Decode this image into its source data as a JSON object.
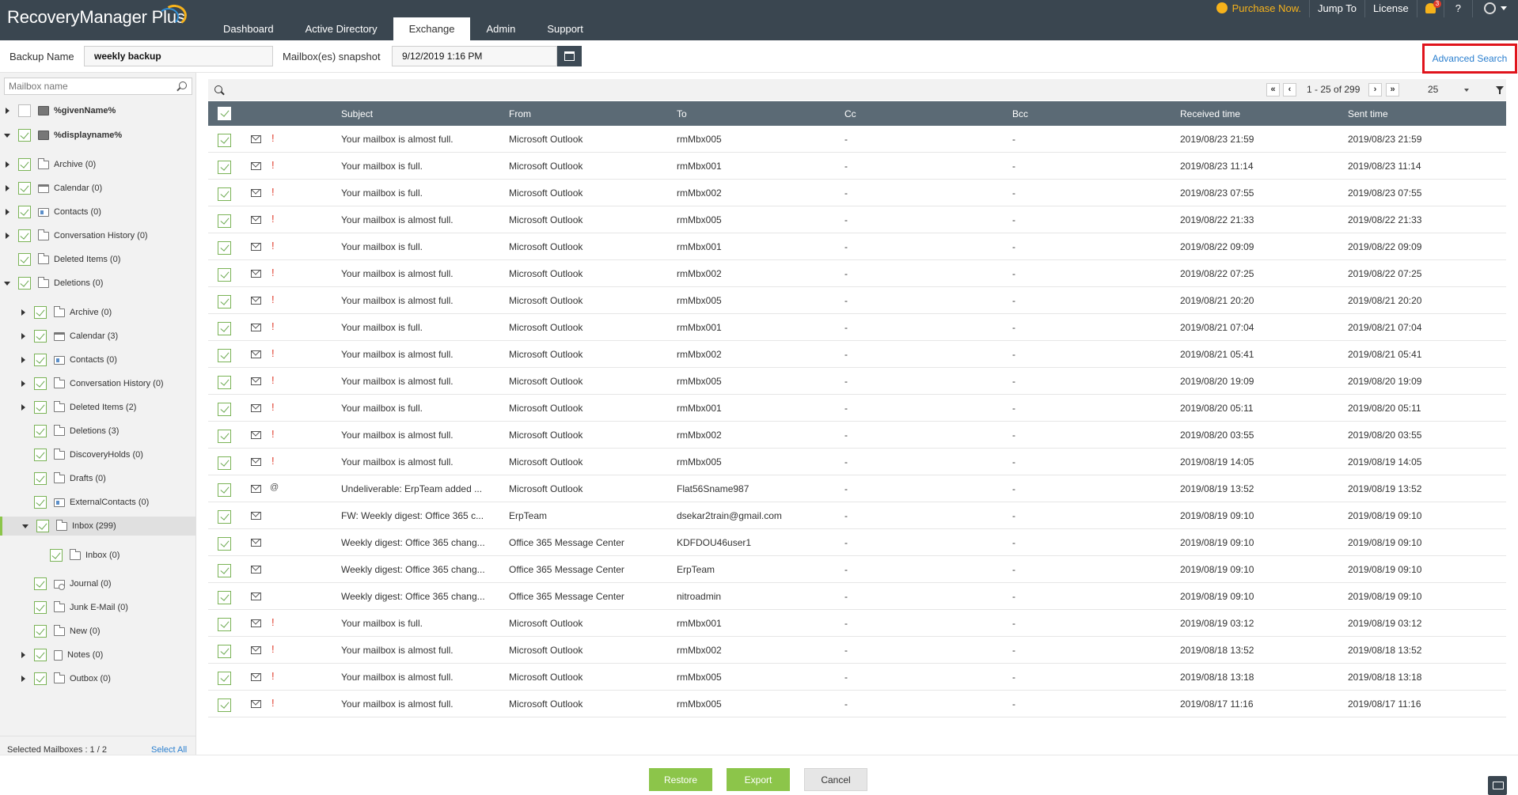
{
  "app": {
    "name": "RecoveryManager",
    "plus": "Plus"
  },
  "nav": {
    "tabs": [
      {
        "label": "Dashboard"
      },
      {
        "label": "Active Directory"
      },
      {
        "label": "Exchange",
        "active": true
      },
      {
        "label": "Admin"
      },
      {
        "label": "Support"
      }
    ]
  },
  "topright": {
    "purchase": "Purchase Now.",
    "jump": "Jump To",
    "license": "License",
    "notif_count": "3",
    "help": "?"
  },
  "filters": {
    "backup_label": "Backup Name",
    "backup_value": "weekly backup",
    "snapshot_label": "Mailbox(es) snapshot",
    "snapshot_value": "9/12/2019 1:16 PM",
    "advanced_search": "Advanced Search"
  },
  "sidebar": {
    "search_placeholder": "Mailbox name",
    "tree": [
      {
        "label": "%givenName%",
        "bold": true,
        "icon": "db",
        "indent": 0,
        "arrow": "r",
        "checked": false
      },
      {
        "label": "%displayname%",
        "bold": true,
        "icon": "db",
        "indent": 0,
        "arrow": "d",
        "checked": true
      },
      {
        "label": "Archive (0)",
        "icon": "folder",
        "indent": 1,
        "arrow": "r",
        "checked": true
      },
      {
        "label": "Calendar (0)",
        "icon": "calendar",
        "indent": 1,
        "arrow": "r",
        "checked": true
      },
      {
        "label": "Contacts (0)",
        "icon": "contacts",
        "indent": 1,
        "arrow": "r",
        "checked": true
      },
      {
        "label": "Conversation History (0)",
        "icon": "folder",
        "indent": 1,
        "arrow": "r",
        "checked": true
      },
      {
        "label": "Deleted Items (0)",
        "icon": "folder",
        "indent": 1,
        "arrow": "",
        "checked": true
      },
      {
        "label": "Deletions (0)",
        "icon": "folder",
        "indent": 1,
        "arrow": "d",
        "checked": true
      },
      {
        "label": "Archive (0)",
        "icon": "folder",
        "indent": 2,
        "arrow": "r",
        "checked": true
      },
      {
        "label": "Calendar (3)",
        "icon": "calendar",
        "indent": 2,
        "arrow": "r",
        "checked": true
      },
      {
        "label": "Contacts (0)",
        "icon": "contacts",
        "indent": 2,
        "arrow": "r",
        "checked": true
      },
      {
        "label": "Conversation History (0)",
        "icon": "folder",
        "indent": 2,
        "arrow": "r",
        "checked": true
      },
      {
        "label": "Deleted Items (2)",
        "icon": "folder",
        "indent": 2,
        "arrow": "r",
        "checked": true
      },
      {
        "label": "Deletions (3)",
        "icon": "folder",
        "indent": 2,
        "arrow": "",
        "checked": true
      },
      {
        "label": "DiscoveryHolds (0)",
        "icon": "folder",
        "indent": 2,
        "arrow": "",
        "checked": true
      },
      {
        "label": "Drafts (0)",
        "icon": "folder",
        "indent": 2,
        "arrow": "",
        "checked": true
      },
      {
        "label": "ExternalContacts (0)",
        "icon": "contacts",
        "indent": 2,
        "arrow": "",
        "checked": true
      },
      {
        "label": "Inbox (299)",
        "icon": "folder",
        "indent": 2,
        "arrow": "d",
        "checked": true,
        "selected": true
      },
      {
        "label": "Inbox (0)",
        "icon": "folder",
        "indent": 3,
        "arrow": "",
        "checked": true
      },
      {
        "label": "Journal (0)",
        "icon": "journal",
        "indent": 2,
        "arrow": "",
        "checked": true
      },
      {
        "label": "Junk E-Mail (0)",
        "icon": "folder",
        "indent": 2,
        "arrow": "",
        "checked": true
      },
      {
        "label": "New (0)",
        "icon": "folder",
        "indent": 2,
        "arrow": "",
        "checked": true
      },
      {
        "label": "Notes (0)",
        "icon": "notes",
        "indent": 2,
        "arrow": "r",
        "checked": true
      },
      {
        "label": "Outbox (0)",
        "icon": "folder",
        "indent": 2,
        "arrow": "r",
        "checked": true
      }
    ],
    "selected_mailboxes": "Selected Mailboxes : 1 / 2",
    "select_all": "Select All"
  },
  "pager": {
    "range": "1 - 25 of 299",
    "page_size": "25",
    "first": "«",
    "prev": "‹",
    "next": "›",
    "last": "»"
  },
  "table": {
    "columns": {
      "subject": "Subject",
      "from": "From",
      "to": "To",
      "cc": "Cc",
      "bcc": "Bcc",
      "received": "Received time",
      "sent": "Sent time"
    },
    "rows": [
      {
        "flag": "!",
        "subject": "Your mailbox is almost full.",
        "from": "Microsoft Outlook",
        "to": "rmMbx005",
        "cc": "-",
        "bcc": "-",
        "received": "2019/08/23 21:59",
        "sent": "2019/08/23 21:59"
      },
      {
        "flag": "!",
        "subject": "Your mailbox is full.",
        "from": "Microsoft Outlook",
        "to": "rmMbx001",
        "cc": "-",
        "bcc": "-",
        "received": "2019/08/23 11:14",
        "sent": "2019/08/23 11:14"
      },
      {
        "flag": "!",
        "subject": "Your mailbox is full.",
        "from": "Microsoft Outlook",
        "to": "rmMbx002",
        "cc": "-",
        "bcc": "-",
        "received": "2019/08/23 07:55",
        "sent": "2019/08/23 07:55"
      },
      {
        "flag": "!",
        "subject": "Your mailbox is almost full.",
        "from": "Microsoft Outlook",
        "to": "rmMbx005",
        "cc": "-",
        "bcc": "-",
        "received": "2019/08/22 21:33",
        "sent": "2019/08/22 21:33"
      },
      {
        "flag": "!",
        "subject": "Your mailbox is full.",
        "from": "Microsoft Outlook",
        "to": "rmMbx001",
        "cc": "-",
        "bcc": "-",
        "received": "2019/08/22 09:09",
        "sent": "2019/08/22 09:09"
      },
      {
        "flag": "!",
        "subject": "Your mailbox is almost full.",
        "from": "Microsoft Outlook",
        "to": "rmMbx002",
        "cc": "-",
        "bcc": "-",
        "received": "2019/08/22 07:25",
        "sent": "2019/08/22 07:25"
      },
      {
        "flag": "!",
        "subject": "Your mailbox is almost full.",
        "from": "Microsoft Outlook",
        "to": "rmMbx005",
        "cc": "-",
        "bcc": "-",
        "received": "2019/08/21 20:20",
        "sent": "2019/08/21 20:20"
      },
      {
        "flag": "!",
        "subject": "Your mailbox is full.",
        "from": "Microsoft Outlook",
        "to": "rmMbx001",
        "cc": "-",
        "bcc": "-",
        "received": "2019/08/21 07:04",
        "sent": "2019/08/21 07:04"
      },
      {
        "flag": "!",
        "subject": "Your mailbox is almost full.",
        "from": "Microsoft Outlook",
        "to": "rmMbx002",
        "cc": "-",
        "bcc": "-",
        "received": "2019/08/21 05:41",
        "sent": "2019/08/21 05:41"
      },
      {
        "flag": "!",
        "subject": "Your mailbox is almost full.",
        "from": "Microsoft Outlook",
        "to": "rmMbx005",
        "cc": "-",
        "bcc": "-",
        "received": "2019/08/20 19:09",
        "sent": "2019/08/20 19:09"
      },
      {
        "flag": "!",
        "subject": "Your mailbox is full.",
        "from": "Microsoft Outlook",
        "to": "rmMbx001",
        "cc": "-",
        "bcc": "-",
        "received": "2019/08/20 05:11",
        "sent": "2019/08/20 05:11"
      },
      {
        "flag": "!",
        "subject": "Your mailbox is almost full.",
        "from": "Microsoft Outlook",
        "to": "rmMbx002",
        "cc": "-",
        "bcc": "-",
        "received": "2019/08/20 03:55",
        "sent": "2019/08/20 03:55"
      },
      {
        "flag": "!",
        "subject": "Your mailbox is almost full.",
        "from": "Microsoft Outlook",
        "to": "rmMbx005",
        "cc": "-",
        "bcc": "-",
        "received": "2019/08/19 14:05",
        "sent": "2019/08/19 14:05"
      },
      {
        "flag": "@",
        "subject": "Undeliverable: ErpTeam added ...",
        "from": "Microsoft Outlook",
        "to": "Flat56Sname987",
        "cc": "-",
        "bcc": "-",
        "received": "2019/08/19 13:52",
        "sent": "2019/08/19 13:52"
      },
      {
        "flag": "",
        "subject": "FW: Weekly digest: Office 365 c...",
        "from": "ErpTeam",
        "to": "dsekar2train@gmail.com",
        "cc": "-",
        "bcc": "-",
        "received": "2019/08/19 09:10",
        "sent": "2019/08/19 09:10"
      },
      {
        "flag": "",
        "subject": "Weekly digest: Office 365 chang...",
        "from": "Office 365 Message Center",
        "to": "KDFDOU46user1",
        "cc": "-",
        "bcc": "-",
        "received": "2019/08/19 09:10",
        "sent": "2019/08/19 09:10"
      },
      {
        "flag": "",
        "subject": "Weekly digest: Office 365 chang...",
        "from": "Office 365 Message Center",
        "to": "ErpTeam",
        "cc": "-",
        "bcc": "-",
        "received": "2019/08/19 09:10",
        "sent": "2019/08/19 09:10"
      },
      {
        "flag": "",
        "subject": "Weekly digest: Office 365 chang...",
        "from": "Office 365 Message Center",
        "to": "nitroadmin",
        "cc": "-",
        "bcc": "-",
        "received": "2019/08/19 09:10",
        "sent": "2019/08/19 09:10"
      },
      {
        "flag": "!",
        "subject": "Your mailbox is full.",
        "from": "Microsoft Outlook",
        "to": "rmMbx001",
        "cc": "-",
        "bcc": "-",
        "received": "2019/08/19 03:12",
        "sent": "2019/08/19 03:12"
      },
      {
        "flag": "!",
        "subject": "Your mailbox is almost full.",
        "from": "Microsoft Outlook",
        "to": "rmMbx002",
        "cc": "-",
        "bcc": "-",
        "received": "2019/08/18 13:52",
        "sent": "2019/08/18 13:52"
      },
      {
        "flag": "!",
        "subject": "Your mailbox is almost full.",
        "from": "Microsoft Outlook",
        "to": "rmMbx005",
        "cc": "-",
        "bcc": "-",
        "received": "2019/08/18 13:18",
        "sent": "2019/08/18 13:18"
      },
      {
        "flag": "!",
        "subject": "Your mailbox is almost full.",
        "from": "Microsoft Outlook",
        "to": "rmMbx005",
        "cc": "-",
        "bcc": "-",
        "received": "2019/08/17 11:16",
        "sent": "2019/08/17 11:16"
      }
    ]
  },
  "footer": {
    "restore": "Restore",
    "export": "Export",
    "cancel": "Cancel"
  },
  "colors": {
    "topbar": "#3a4650",
    "header": "#5b6a75",
    "accent_green": "#8cc54a",
    "link": "#2a7fcf",
    "highlight": "#e0141c",
    "purchase": "#f6b21b"
  }
}
